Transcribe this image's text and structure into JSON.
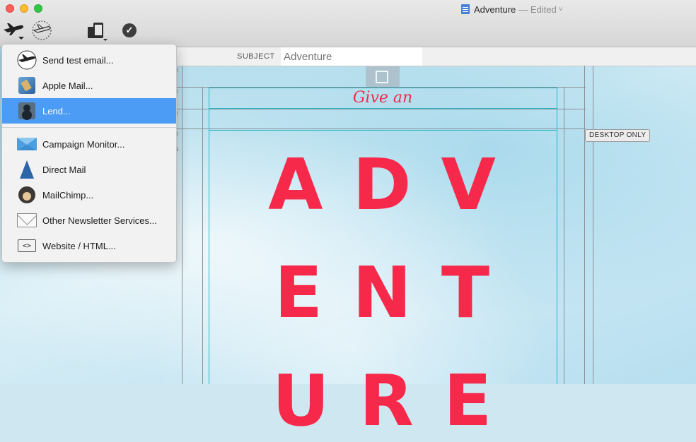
{
  "window": {
    "title": "Adventure",
    "status": "— Edited",
    "title_caret": "˅"
  },
  "toolbar": {
    "send_icon": "airplane-send-icon",
    "send_outline_icon": "airplane-outline-icon",
    "device_icon": "device-preview-icon",
    "check_icon": "checkmark-icon",
    "check_glyph": "✓"
  },
  "subject": {
    "label": "SUBJECT",
    "placeholder": "Adventure"
  },
  "menu": {
    "items": [
      {
        "label": "Send test email...",
        "icon": "airplane-icon"
      },
      {
        "label": "Apple Mail...",
        "icon": "apple-mail-icon"
      },
      {
        "label": "Lend...",
        "icon": "lend-icon"
      },
      {
        "label": "Campaign Monitor...",
        "icon": "campaign-monitor-icon"
      },
      {
        "label": "Direct Mail",
        "icon": "direct-mail-icon"
      },
      {
        "label": "MailChimp...",
        "icon": "mailchimp-icon"
      },
      {
        "label": "Other Newsletter Services...",
        "icon": "envelope-icon"
      },
      {
        "label": "Website / HTML...",
        "icon": "html-code-icon"
      }
    ],
    "highlighted_index": 2,
    "html_glyph": "<>"
  },
  "canvas": {
    "give_an": "Give an",
    "line1": "ADV",
    "line2": "ENT",
    "line3": "URE",
    "desktop_only": "DESKTOP ONLY",
    "close_glyph": "×",
    "menu_glyph": "≡"
  },
  "colors": {
    "accent_red": "#f7294b",
    "menu_highlight": "#4c9bf5",
    "guide_teal": "#24b7c7"
  }
}
